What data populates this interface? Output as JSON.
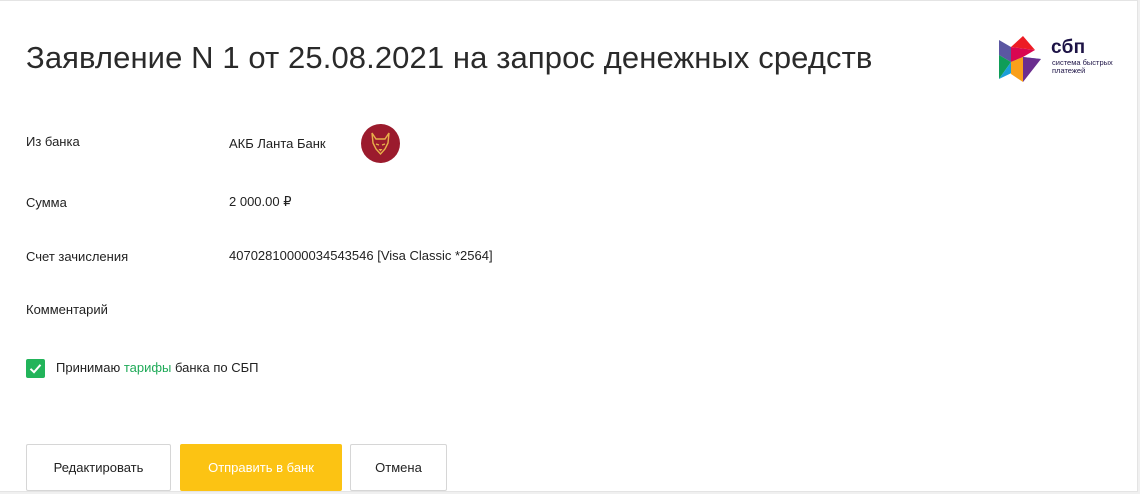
{
  "header": {
    "title": "Заявление N 1 от 25.08.2021 на запрос денежных средств",
    "sbp_logo": {
      "word": "сбп",
      "subtitle": "система быстрых платежей"
    }
  },
  "fields": {
    "bank": {
      "label": "Из банка",
      "value": "АКБ Ланта Банк",
      "logo_icon": "lanta-bank-wolf-icon"
    },
    "amount": {
      "label": "Сумма",
      "value": "2 000.00 ₽"
    },
    "account": {
      "label": "Счет зачисления",
      "value": "40702810000034543546 [Visa Classic *2564]"
    },
    "comment": {
      "label": "Комментарий"
    }
  },
  "consent": {
    "checked": true,
    "prefix": "Принимаю ",
    "link": "тарифы",
    "suffix": " банка по СБП"
  },
  "actions": {
    "edit": "Редактировать",
    "send": "Отправить в банк",
    "cancel": "Отмена"
  },
  "colors": {
    "primary": "#fcc313",
    "accent_green": "#22b45a",
    "link_green": "#1faa58",
    "bank_logo": "#9b1b2d",
    "sbp_dark": "#1d1346"
  }
}
